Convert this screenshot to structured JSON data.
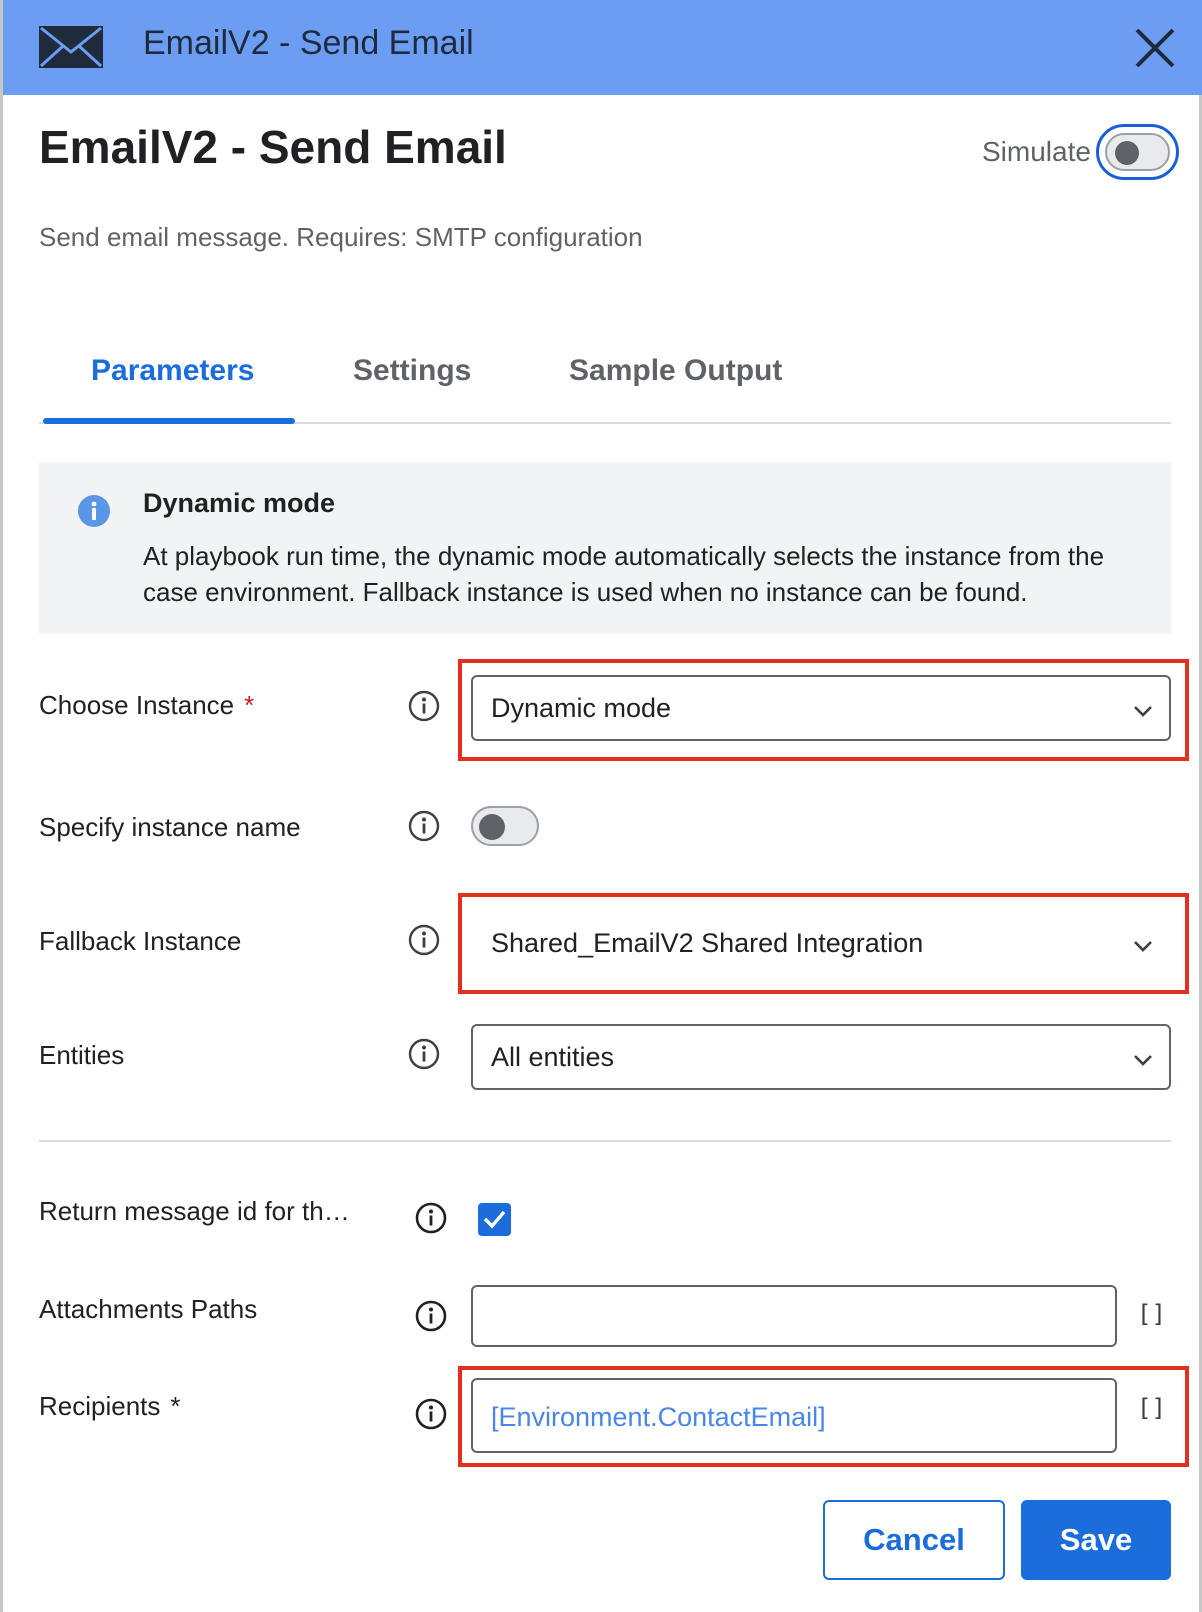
{
  "titlebar": {
    "title": "EmailV2 - Send Email",
    "icon": "mail-icon",
    "close_icon": "close-icon",
    "color": "#6b9ef3"
  },
  "header": {
    "title": "EmailV2 - Send Email",
    "simulate_label": "Simulate",
    "simulate_on": false,
    "description": "Send email message. Requires: SMTP configuration"
  },
  "tabs": [
    {
      "label": "Parameters",
      "active": true
    },
    {
      "label": "Settings",
      "active": false
    },
    {
      "label": "Sample Output",
      "active": false
    }
  ],
  "banner": {
    "icon": "info-icon",
    "title": "Dynamic mode",
    "text": "At playbook run time, the dynamic mode automatically selects the instance from the case environment. Fallback instance is used when no instance can be found."
  },
  "fields": {
    "choose_instance": {
      "label": "Choose Instance",
      "required_mark": "*",
      "value": "Dynamic mode"
    },
    "specify_instance_name": {
      "label": "Specify instance name",
      "enabled": false
    },
    "fallback_instance": {
      "label": "Fallback Instance",
      "value": "Shared_EmailV2 Shared Integration"
    },
    "entities": {
      "label": "Entities",
      "value": "All entities"
    },
    "return_message_id": {
      "label": "Return message id for th…",
      "checked": true
    },
    "attachments_paths": {
      "label": "Attachments Paths",
      "value": "",
      "bracket": "[]"
    },
    "recipients": {
      "label": "Recipients",
      "required_mark": "*",
      "value": "[Environment.ContactEmail]",
      "bracket": "[]"
    }
  },
  "buttons": {
    "cancel": "Cancel",
    "save": "Save"
  },
  "colors": {
    "accent": "#1a6ddb",
    "highlight": "#e0301e",
    "link_value": "#4a86e8"
  }
}
